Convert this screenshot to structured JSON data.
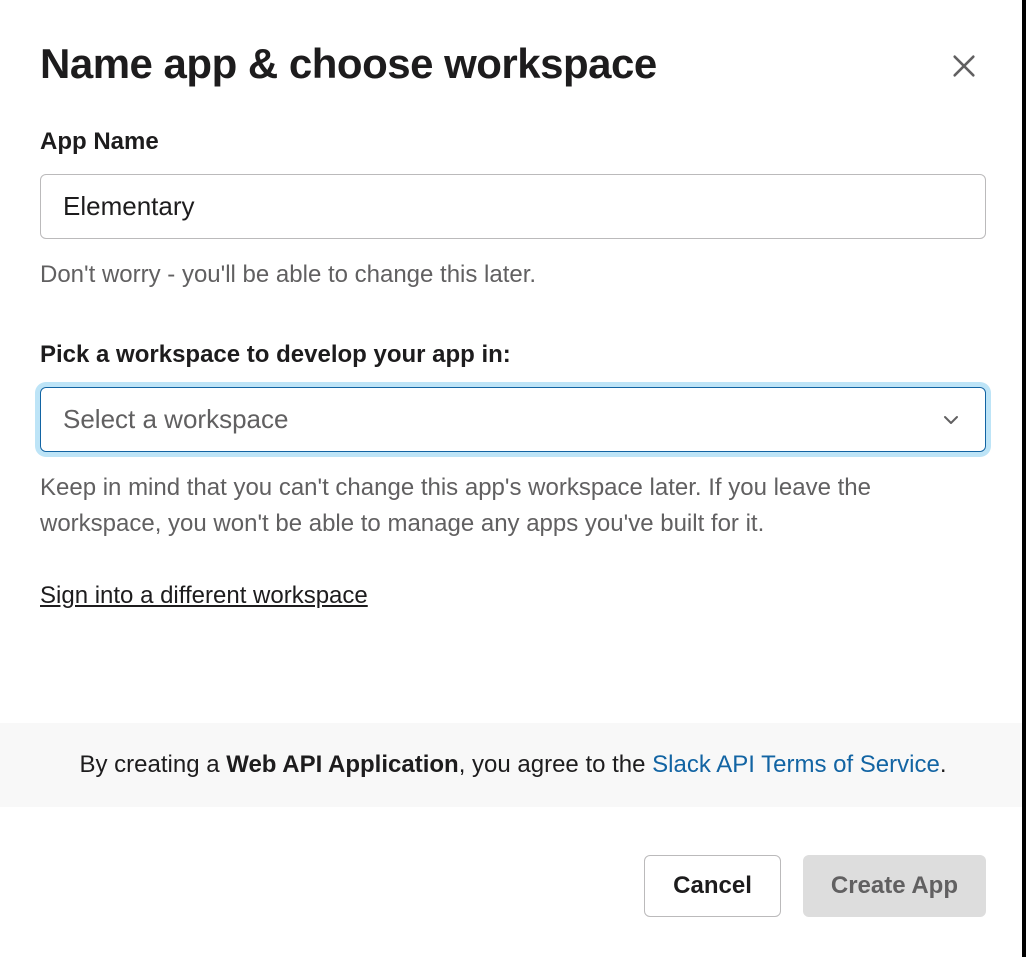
{
  "modal": {
    "title": "Name app & choose workspace",
    "appName": {
      "label": "App Name",
      "value": "Elementary",
      "helper": "Don't worry - you'll be able to change this later."
    },
    "workspace": {
      "label": "Pick a workspace to develop your app in:",
      "placeholder": "Select a workspace",
      "helper": "Keep in mind that you can't change this app's workspace later. If you leave the workspace, you won't be able to manage any apps you've built for it."
    },
    "signInLink": "Sign into a different workspace",
    "tos": {
      "prefix": "By creating a ",
      "strong": "Web API Application",
      "middle": ", you agree to the ",
      "linkText": "Slack API Terms of Service",
      "suffix": "."
    },
    "buttons": {
      "cancel": "Cancel",
      "create": "Create App"
    }
  }
}
